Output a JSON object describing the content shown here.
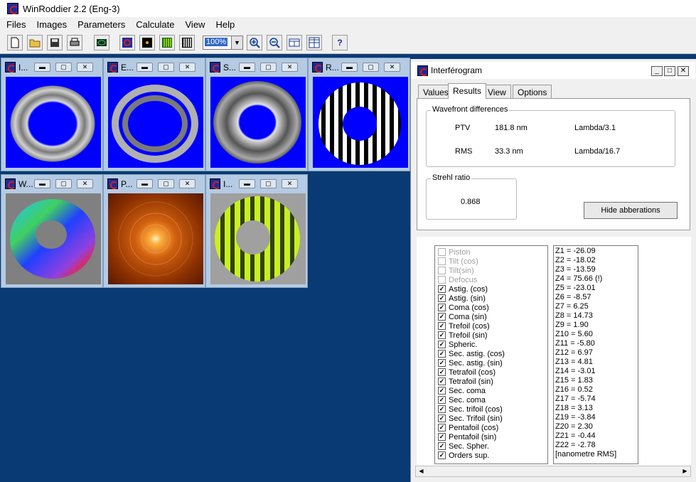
{
  "app": {
    "title": "WinRoddier 2.2 (Eng-3)"
  },
  "menu": [
    "Files",
    "Images",
    "Parameters",
    "Calculate",
    "View",
    "Help"
  ],
  "toolbar": {
    "zoom": "100%",
    "help": "?"
  },
  "thumbs": [
    {
      "title": "I..."
    },
    {
      "title": "E..."
    },
    {
      "title": "S..."
    },
    {
      "title": "R..."
    },
    {
      "title": "W..."
    },
    {
      "title": "P..."
    },
    {
      "title": "I..."
    }
  ],
  "panel": {
    "title": "Interférogram",
    "tabs": [
      "Values",
      "Results",
      "View",
      "Options"
    ],
    "wavefront": {
      "label": "Wavefront differences",
      "ptv_label": "PTV",
      "ptv_value": "181.8 nm",
      "ptv_lambda": "Lambda/3.1",
      "rms_label": "RMS",
      "rms_value": "33.3 nm",
      "rms_lambda": "Lambda/16.7"
    },
    "strehl": {
      "label": "Strehl ratio",
      "value": "0.868"
    },
    "hide_button": "Hide abberations",
    "aberrations": [
      {
        "label": "Piston",
        "checked": false,
        "disabled": true
      },
      {
        "label": "Tilt (cos)",
        "checked": false,
        "disabled": true
      },
      {
        "label": "Tilt(sin)",
        "checked": false,
        "disabled": true
      },
      {
        "label": "Defocus",
        "checked": false,
        "disabled": true
      },
      {
        "label": "Astig. (cos)",
        "checked": true,
        "disabled": false
      },
      {
        "label": "Astig. (sin)",
        "checked": true,
        "disabled": false
      },
      {
        "label": "Coma (cos)",
        "checked": true,
        "disabled": false
      },
      {
        "label": "Coma (sin)",
        "checked": true,
        "disabled": false
      },
      {
        "label": "Trefoil (cos)",
        "checked": true,
        "disabled": false
      },
      {
        "label": "Trefoil (sin)",
        "checked": true,
        "disabled": false
      },
      {
        "label": "Spheric.",
        "checked": true,
        "disabled": false
      },
      {
        "label": "Sec. astig. (cos)",
        "checked": true,
        "disabled": false
      },
      {
        "label": "Sec. astig. (sin)",
        "checked": true,
        "disabled": false
      },
      {
        "label": "Tetrafoil (cos)",
        "checked": true,
        "disabled": false
      },
      {
        "label": "Tetrafoil (sin)",
        "checked": true,
        "disabled": false
      },
      {
        "label": "Sec. coma",
        "checked": true,
        "disabled": false
      },
      {
        "label": "Sec. coma",
        "checked": true,
        "disabled": false
      },
      {
        "label": "Sec. trifoil (cos)",
        "checked": true,
        "disabled": false
      },
      {
        "label": "Sec. Trifoil (sin)",
        "checked": true,
        "disabled": false
      },
      {
        "label": "Pentafoil (cos)",
        "checked": true,
        "disabled": false
      },
      {
        "label": "Pentafoil (sin)",
        "checked": true,
        "disabled": false
      },
      {
        "label": "Sec. Spher.",
        "checked": true,
        "disabled": false
      },
      {
        "label": "Orders sup.",
        "checked": true,
        "disabled": false
      }
    ],
    "zernikes": [
      "Z1 = -26.09",
      "Z2 = -18.02",
      "Z3 = -13.59",
      "Z4 = 75.66  (!)",
      "Z5 = -23.01",
      "Z6 = -8.57",
      "Z7 = 6.25",
      "Z8 = 14.73",
      "Z9 = 1.90",
      "Z10 = 5.60",
      "Z11 = -5.80",
      "Z12 = 6.97",
      "Z13 = 4.81",
      "Z14 = -3.01",
      "Z15 = 1.83",
      "Z16 = 0.52",
      "Z17 = -5.74",
      "Z18 = 3.13",
      "Z19 = -3.84",
      "Z20 = 2.30",
      "Z21 = -0.44",
      "Z22 = -2.78",
      "[nanometre RMS]"
    ]
  }
}
